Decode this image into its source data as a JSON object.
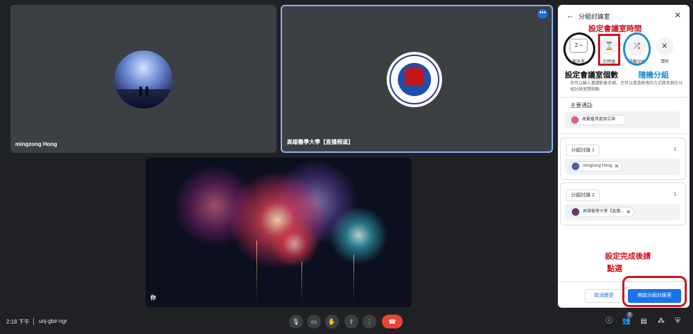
{
  "tiles": {
    "participant1": {
      "name": "mingzong Hong"
    },
    "participant2": {
      "name": "高雄醫學大學【直播頻道】",
      "seal_text": "高醫"
    },
    "self": {
      "name": "你"
    }
  },
  "panel": {
    "title": "分組討論室",
    "controls": {
      "rooms_value": "2 ÷",
      "rooms_label": "聊天室",
      "timer_label": "計時器",
      "shuffle_label": "隨機分組",
      "clear_label": "清除"
    },
    "hint": "你可以輸入邀請對象名稱，也可以透過拖曳的方式將名稱在分組討論室間移動",
    "main_room": {
      "label": "主要通話",
      "participants": [
        {
          "name": "高醫番資處周立與"
        }
      ]
    },
    "rooms": [
      {
        "name": "分組討論 1",
        "count": "1",
        "participants": [
          {
            "name": "mingzong Hong"
          }
        ]
      },
      {
        "name": "分組討論 2",
        "count": "1",
        "participants": [
          {
            "name": "高雄醫學大學【直播..."
          }
        ]
      }
    ],
    "cancel_label": "取消變更",
    "open_label": "開啟分組討論室"
  },
  "annotations": {
    "timer": "設定會議室時間",
    "count": "設定會議室個數",
    "random": "隨機分組",
    "done_line1": "設定完成後請",
    "done_line2": "點選"
  },
  "bottom_bar": {
    "time": "2:18 下午",
    "meeting_code": "unj-gbir-ngr",
    "people_count": "3"
  },
  "colors": {
    "accent": "#1a73e8",
    "end_call": "#ea4335",
    "annotation_red": "#d0121b",
    "annotation_blue": "#1b8fd6"
  },
  "icons": [
    "back-arrow-icon",
    "close-icon",
    "hourglass-icon",
    "shuffle-icon",
    "clear-icon",
    "mic-icon",
    "camera-icon",
    "hand-icon",
    "present-icon",
    "more-icon",
    "end-call-icon",
    "info-icon",
    "people-icon",
    "chat-icon",
    "activities-icon",
    "shield-icon"
  ]
}
